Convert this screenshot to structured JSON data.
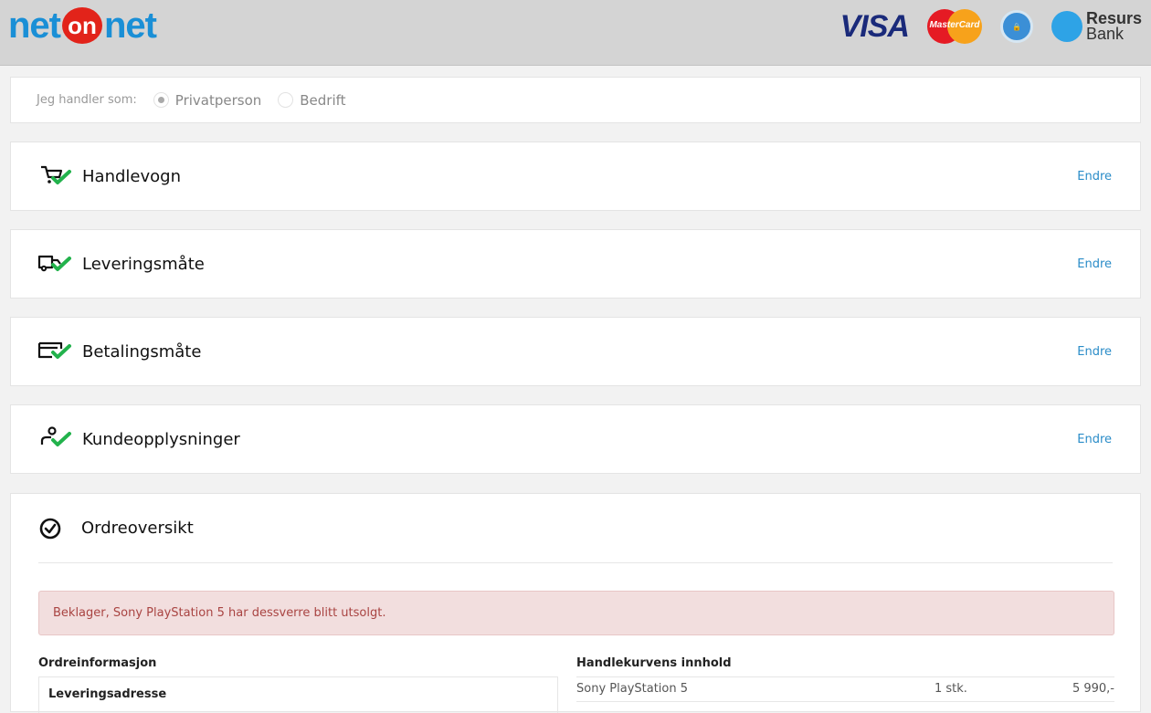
{
  "header": {
    "logo": {
      "left": "net",
      "mid": "on",
      "right": "net"
    },
    "payment_logos": {
      "visa": "VISA",
      "mastercard": "MasterCard",
      "trust": "TRYGG E-HANDEL",
      "resurs_line1": "Resurs",
      "resurs_line2": "Bank"
    }
  },
  "shopper": {
    "label": "Jeg handler som:",
    "options": [
      {
        "label": "Privatperson",
        "selected": true
      },
      {
        "label": "Bedrift",
        "selected": false
      }
    ]
  },
  "steps": [
    {
      "title": "Handlevogn",
      "edit": "Endre",
      "icon": "cart-check-icon"
    },
    {
      "title": "Leveringsmåte",
      "edit": "Endre",
      "icon": "truck-check-icon"
    },
    {
      "title": "Betalingsmåte",
      "edit": "Endre",
      "icon": "card-check-icon"
    },
    {
      "title": "Kundeopplysninger",
      "edit": "Endre",
      "icon": "user-check-icon"
    }
  ],
  "overview": {
    "title": "Ordreoversikt",
    "icon": "circle-check-icon",
    "alert": "Beklager, Sony PlayStation 5 har dessverre blitt utsolgt.",
    "order_info_title": "Ordreinformasjon",
    "delivery_address_label": "Leveringsadresse",
    "cart_title": "Handlekurvens innhold",
    "cart_items": [
      {
        "name": "Sony PlayStation 5",
        "qty": "1 stk.",
        "price": "5 990,-"
      }
    ]
  },
  "colors": {
    "brand_blue": "#1a8fd6",
    "brand_red": "#e2231a",
    "check_green": "#22b24c",
    "link_blue": "#2a8cc8",
    "alert_bg": "#f2dede",
    "alert_text": "#a94442"
  }
}
